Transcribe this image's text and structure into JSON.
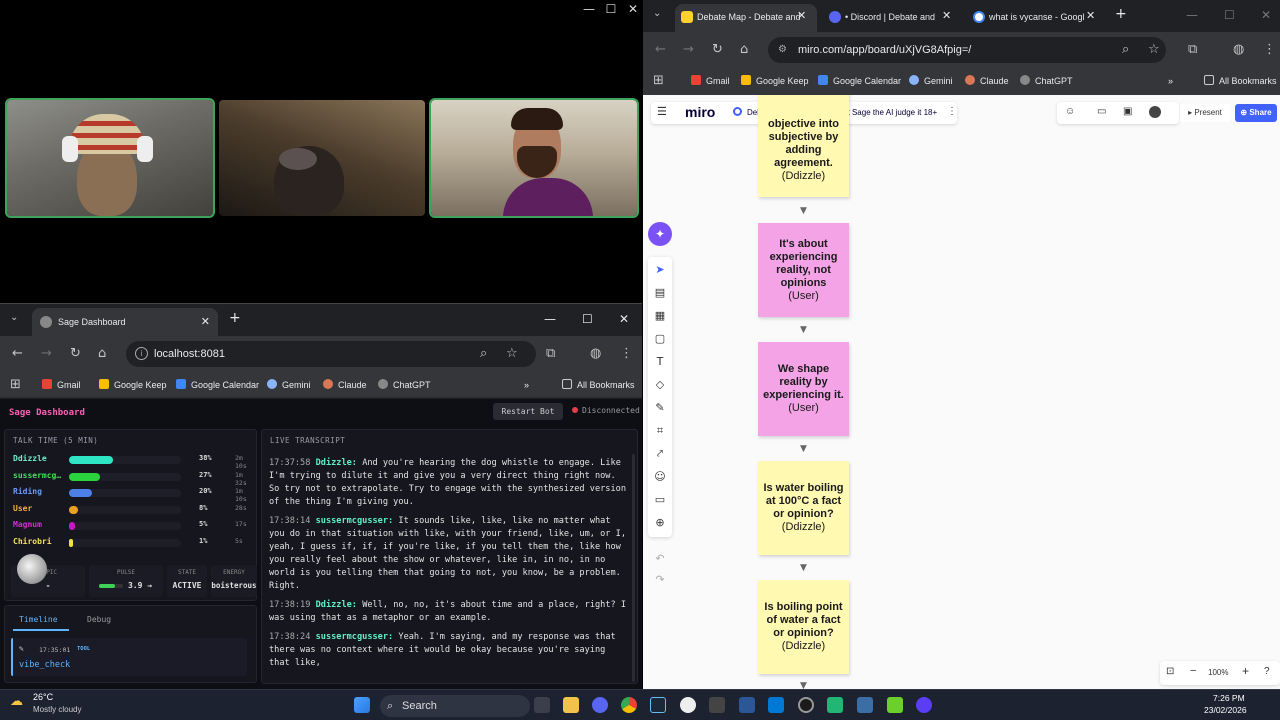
{
  "video_call": {
    "controls": [
      "—",
      "☐",
      "✕"
    ]
  },
  "sage_browser": {
    "tab_title": "Sage Dashboard",
    "url": "localhost:8081",
    "bookmarks": [
      "Gmail",
      "Google Keep",
      "Google Calendar",
      "Gemini",
      "Claude",
      "ChatGPT"
    ],
    "all_bookmarks": "All Bookmarks"
  },
  "sage": {
    "title": "Sage Dashboard",
    "restart_label": "Restart Bot",
    "status": "Disconnected",
    "talk_time_header": "TALK TIME (5 MIN)",
    "talk_time": [
      {
        "name": "Ddizzle",
        "pct_label": "38%",
        "fraction": 0.38,
        "time": "2m 10s",
        "color": "#2ee6c4",
        "name_color": "#6ff0c8"
      },
      {
        "name": "sussermcg…",
        "pct_label": "27%",
        "fraction": 0.27,
        "time": "1m 32s",
        "color": "#29d43c",
        "name_color": "#45e05a"
      },
      {
        "name": "Riding",
        "pct_label": "20%",
        "fraction": 0.2,
        "time": "1m 10s",
        "color": "#4d7fe8",
        "name_color": "#6a9cf2"
      },
      {
        "name": "User",
        "pct_label": "8%",
        "fraction": 0.08,
        "time": "28s",
        "color": "#e9a21e",
        "name_color": "#f2b23a"
      },
      {
        "name": "Magnum",
        "pct_label": "5%",
        "fraction": 0.05,
        "time": "17s",
        "color": "#c418c9",
        "name_color": "#d030d0"
      },
      {
        "name": "Chirobri",
        "pct_label": "1%",
        "fraction": 0.01,
        "time": "5s",
        "color": "#f0e040",
        "name_color": "#f4e45a"
      }
    ],
    "stats": [
      {
        "label": "TOPIC",
        "value": "-"
      },
      {
        "label": "PULSE",
        "value": "3.9 →"
      },
      {
        "label": "STATE",
        "value": "ACTIVE"
      },
      {
        "label": "ENERGY",
        "value": "boisterous"
      }
    ],
    "pulse_fraction": 0.39,
    "tabs": [
      "Timeline",
      "Debug"
    ],
    "timeline_item": {
      "time": "17:35:01",
      "tag": "TOOL",
      "text": "vibe_check"
    },
    "transcript_header": "LIVE TRANSCRIPT",
    "transcript": [
      {
        "ts": "17:37:58",
        "speaker": "Ddizzle:",
        "text": "And you're hearing the dog whistle to engage. Like I'm trying to dilute it and give you a very direct thing right now. So try not to extrapolate. Try to engage with the synthesized version of the thing I'm giving you."
      },
      {
        "ts": "17:38:14",
        "speaker": "sussermcgusser:",
        "text": "It sounds like, like, like no matter what you do in that situation with like, with your friend, like, um, or I, yeah, I guess if, if, if you're like, if you tell them the, like how you really feel about the show or whatever, like in, in no, in no world is you telling them that going to not, you know, be a problem. Right."
      },
      {
        "ts": "17:38:19",
        "speaker": "Ddizzle:",
        "text": "Well, no, no, it's about time and a place, right? I was using that as a metaphor or an example."
      },
      {
        "ts": "17:38:24",
        "speaker": "sussermcgusser:",
        "text": "Yeah. I'm saying, and my response was that there was no context where it would be okay because you're saying that like,"
      }
    ]
  },
  "miro_browser": {
    "tabs": [
      {
        "title": "Debate Map - Debate and",
        "color": "#ffd02f"
      },
      {
        "title": "• Discord | Debate and t",
        "color": "#5865f2"
      },
      {
        "title": "what is vycanse - Googl",
        "color": "#ffffff"
      }
    ],
    "url": "miro.com/app/board/uXjVG8Afpig=/",
    "bookmarks": [
      "Gmail",
      "Google Keep",
      "Google Calendar",
      "Gemini",
      "Claude",
      "ChatGPT"
    ],
    "all_bookmarks": "All Bookmarks"
  },
  "miro": {
    "logo": "miro",
    "board_name": "Debate Map - Debate and let Sage the AI judge it 18+",
    "present_label": "Present",
    "share_label": "Share",
    "zoom": "100%",
    "stickies": [
      {
        "text": "objective into subjective by adding agreement.",
        "author": "(Ddizzle)",
        "color": "yellow"
      },
      {
        "text": "It's about experiencing reality, not opinions",
        "author": "(User)",
        "color": "pink"
      },
      {
        "text": "We shape reality by experiencing it.",
        "author": "(User)",
        "color": "pink"
      },
      {
        "text": "Is water boiling at 100°C a fact or opinion?",
        "author": "(Ddizzle)",
        "color": "yellow"
      },
      {
        "text": "Is boiling point of water a fact or opinion?",
        "author": "(Ddizzle)",
        "color": "yellow"
      }
    ]
  },
  "taskbar": {
    "weather_temp": "26°C",
    "weather_desc": "Mostly cloudy",
    "search_label": "Search",
    "time": "7:26 PM",
    "date": "23/02/2026"
  }
}
